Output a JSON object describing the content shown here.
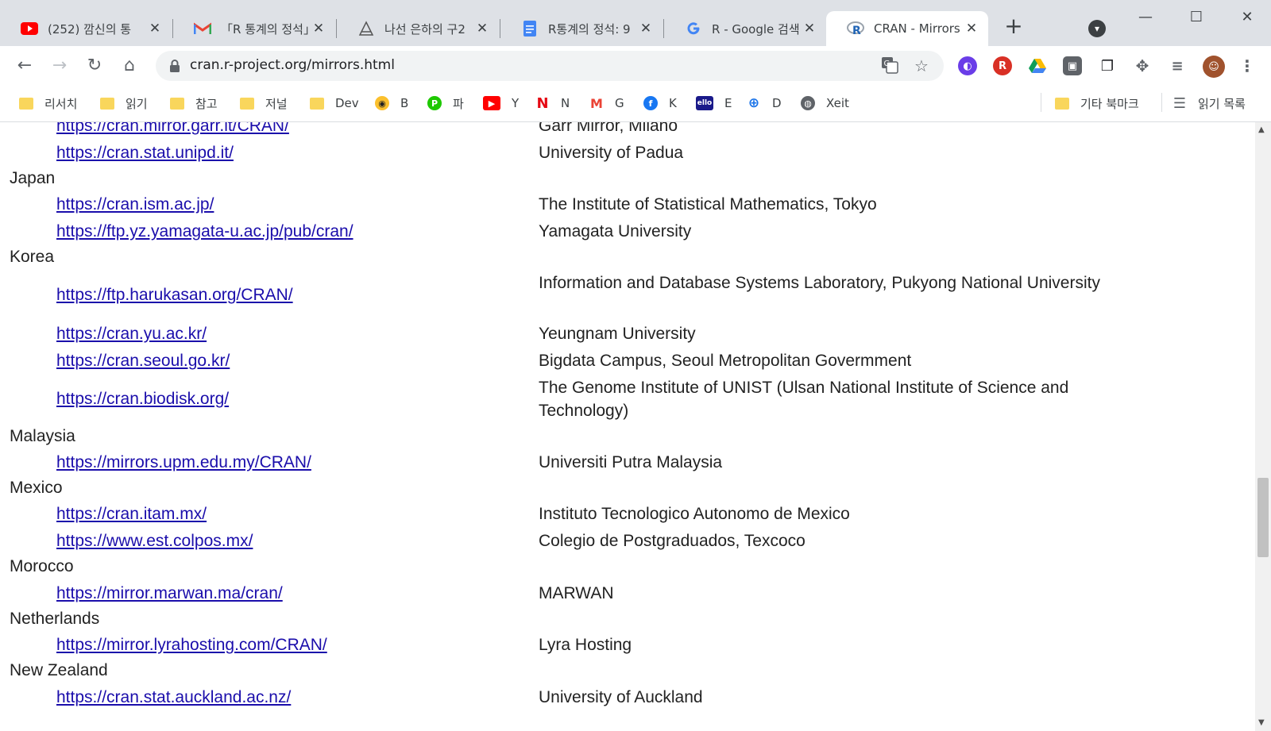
{
  "tabs": [
    {
      "title": "(252) 깜신의 통",
      "favicon": "youtube-icon",
      "color": "#ff0000"
    },
    {
      "title": "「R 통계의 정석」",
      "favicon": "gmail-icon",
      "color": "#ea4335"
    },
    {
      "title": "나선 은하의 구2",
      "favicon": "galaxy-icon",
      "color": "#555555"
    },
    {
      "title": "R통계의 정석: 9",
      "favicon": "docs-icon",
      "color": "#4285f4"
    },
    {
      "title": "R - Google 검색",
      "favicon": "google-icon",
      "color": "#4285f4"
    },
    {
      "title": "CRAN - Mirrors",
      "favicon": "r-logo-icon",
      "color": "#2165b6",
      "active": true
    }
  ],
  "toolbar": {
    "url": "cran.r-project.org/mirrors.html"
  },
  "bookmarks": {
    "left": [
      {
        "label": "리서치",
        "icon": "folder-icon"
      },
      {
        "label": "읽기",
        "icon": "folder-icon"
      },
      {
        "label": "참고",
        "icon": "folder-icon"
      },
      {
        "label": "저널",
        "icon": "folder-icon"
      },
      {
        "label": "Dev",
        "icon": "folder-icon"
      },
      {
        "label": "B",
        "icon": "b-site-icon"
      },
      {
        "label": "파",
        "icon": "papago-icon"
      },
      {
        "label": "Y",
        "icon": "youtube-icon"
      },
      {
        "label": "N",
        "icon": "netflix-icon"
      },
      {
        "label": "G",
        "icon": "gmail-icon"
      },
      {
        "label": "K",
        "icon": "facebook-icon"
      },
      {
        "label": "E",
        "icon": "ello-icon"
      },
      {
        "label": "D",
        "icon": "globe-icon"
      },
      {
        "label": "Xeit",
        "icon": "xeit-icon"
      }
    ],
    "other": "기타 북마크",
    "reading_list": "읽기 목록"
  },
  "mirrors": {
    "garr_url": "https://cran.mirror.garr.it/CRAN/",
    "garr_desc": "Garr Mirror, Milano",
    "padua_url": "https://cran.stat.unipd.it/",
    "padua_desc": "University of Padua",
    "japan": "Japan",
    "ism_url": "https://cran.ism.ac.jp/",
    "ism_desc": "The Institute of Statistical Mathematics, Tokyo",
    "yamagata_url": "https://ftp.yz.yamagata-u.ac.jp/pub/cran/",
    "yamagata_desc": "Yamagata University",
    "korea": "Korea",
    "harukasan_url": "https://ftp.harukasan.org/CRAN/",
    "harukasan_desc": "Information and Database Systems Laboratory, Pukyong National University",
    "yu_url": "https://cran.yu.ac.kr/",
    "yu_desc": "Yeungnam University",
    "seoul_url": "https://cran.seoul.go.kr/",
    "seoul_desc": "Bigdata Campus, Seoul Metropolitan Govermment",
    "biodisk_url": "https://cran.biodisk.org/",
    "biodisk_desc": "The Genome Institute of UNIST (Ulsan National Institute of Science and Technology)",
    "malaysia": "Malaysia",
    "upm_url": "https://mirrors.upm.edu.my/CRAN/",
    "upm_desc": "Universiti Putra Malaysia",
    "mexico": "Mexico",
    "itam_url": "https://cran.itam.mx/",
    "itam_desc": "Instituto Tecnologico Autonomo de Mexico",
    "colpos_url": "https://www.est.colpos.mx/",
    "colpos_desc": "Colegio de Postgraduados, Texcoco",
    "morocco": "Morocco",
    "marwan_url": "https://mirror.marwan.ma/cran/",
    "marwan_desc": "MARWAN",
    "netherlands": "Netherlands",
    "lyra_url": "https://mirror.lyrahosting.com/CRAN/",
    "lyra_desc": "Lyra Hosting",
    "new_zealand": "New Zealand",
    "auckland_url": "https://cran.stat.auckland.ac.nz/",
    "auckland_desc": "University of Auckland"
  }
}
